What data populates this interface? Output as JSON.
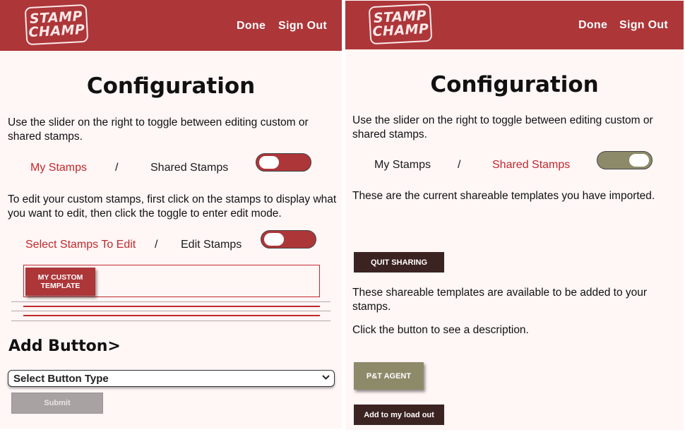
{
  "left": {
    "logo": {
      "line1": "STAMP",
      "line2": "CHAMP"
    },
    "nav": {
      "done": "Done",
      "sign_out": "Sign Out"
    },
    "title": "Configuration",
    "intro": "Use the slider on the right to toggle between editing custom or shared stamps.",
    "toggle1": {
      "left_label": "My Stamps",
      "separator": "/",
      "right_label": "Shared Stamps",
      "state": "off"
    },
    "edit_intro": "To edit your custom stamps, first click on the stamps to display what you want to edit, then click the toggle to enter edit mode.",
    "toggle2": {
      "left_label": "Select Stamps To Edit",
      "separator": "/",
      "right_label": "Edit Stamps",
      "state": "off"
    },
    "stamps": [
      {
        "line1": "MY CUSTOM",
        "line2": "TEMPLATE"
      }
    ],
    "add_button_heading": "Add Button>",
    "select": {
      "value": "Select Button Type"
    },
    "submit_label": "Submit"
  },
  "right": {
    "logo": {
      "line1": "STAMP",
      "line2": "CHAMP"
    },
    "nav": {
      "done": "Done",
      "sign_out": "Sign Out"
    },
    "title": "Configuration",
    "intro": "Use the slider on the right to toggle between editing custom or shared stamps.",
    "toggle": {
      "left_label": "My Stamps",
      "separator": "/",
      "right_label": "Shared Stamps",
      "state": "on"
    },
    "imported_text": "These are the current shareable templates you have imported.",
    "quit_sharing_label": "QUIT SHARING",
    "available_text": "These shareable templates are available to be added to your stamps.",
    "click_text": "Click the button to see a description.",
    "template_button_label": "P&T AGENT",
    "add_loadout_label": "Add to my load out"
  },
  "colors": {
    "header": "#ad3639",
    "accent_red": "#c0292c",
    "toggle_off": "#ad3639",
    "toggle_on": "#8d8a6a",
    "dark_button": "#3b2321",
    "olive_button": "#8d8a6a"
  },
  "icons": {
    "select_chevron": "chevron-down-icon"
  }
}
